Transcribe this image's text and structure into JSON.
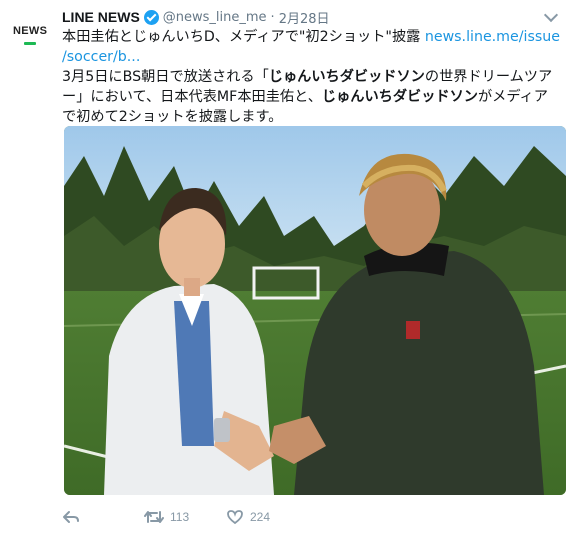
{
  "account": {
    "logo_text": "NEWS",
    "name": "LINE NEWS",
    "handle": "@news_line_me",
    "separator": "·",
    "date": "2月28日"
  },
  "tweet": {
    "line1_text": "本田圭佑とじゅんいちD、メディアで\"初2ショット\"披露 ",
    "line1_link": "news.line.me/issue",
    "line2_link": "/soccer/b...",
    "body_1": "3月5日にBS朝日で放送される「",
    "body_bold_1": "じゅんいちダビッドソン",
    "body_2": "の世界ドリームツアー」において、日本代表MF本田圭佑と、",
    "body_bold_2": "じゅんいちダビッドソン",
    "body_3": "がメディアで初めて2ショットを披露します。"
  },
  "actions": {
    "reply_icon": "reply-icon",
    "retweet_icon": "retweet-icon",
    "retweet_count": "113",
    "like_icon": "heart-icon",
    "like_count": "224"
  },
  "colors": {
    "link": "#1b95e0",
    "verified": "#1da1f2",
    "muted": "#657786",
    "news_accent": "#1db954"
  }
}
